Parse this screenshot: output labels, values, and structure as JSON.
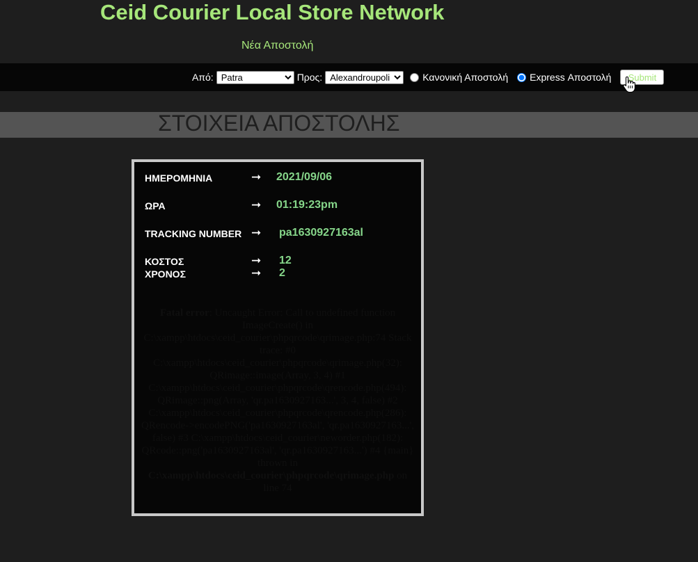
{
  "header": {
    "site_title": "Ceid Courier Local Store Network",
    "nav_link": "Νέα Αποστολή"
  },
  "form": {
    "from_label": "Από:",
    "from_value": "Patra",
    "to_label": "Προς:",
    "to_value": "Alexandroupoli",
    "radio_normal": {
      "label": "Κανονική Αποστολή",
      "checked": false
    },
    "radio_express": {
      "label": "Express Αποστολή",
      "checked": true
    },
    "submit_label": "Submit"
  },
  "section": {
    "title": "ΣΤΟΙΧΕΙΑ ΑΠΟΣΤΟΛΗΣ"
  },
  "details": {
    "date": {
      "label": "ΗΜΕΡΟΜΗΝΙΑ",
      "value": "2021/09/06"
    },
    "time": {
      "label": "ΩΡΑ",
      "value": "01:19:23pm"
    },
    "tracking": {
      "label": "TRACKING NUMBER",
      "value": "pa1630927163al"
    },
    "cost": {
      "label": "ΚΟΣΤΟΣ",
      "value": "12"
    },
    "duration": {
      "label": "ΧΡΟΝΟΣ",
      "value": "2"
    },
    "arrow_icon": "right-arrow-icon"
  },
  "error": {
    "heading": "Fatal error",
    "message": ": Uncaught Error: Call to undefined function ImageCreate() in C:\\xampp\\htdocs\\ceid_courier\\phpqrcode\\qrimage.php:74 Stack trace: #0 C:\\xampp\\htdocs\\ceid_courier\\phpqrcode\\qrimage.php(32): QRimage::image(Array, 3, 4) #1 C:\\xampp\\htdocs\\ceid_courier\\phpqrcode\\qrencode.php(494): QRimage::png(Array, 'qr.pa1630927163...', 3, 4, false) #2 C:\\xampp\\htdocs\\ceid_courier\\phpqrcode\\qrencode.php(286): QRencode->encodePNG('pa1630927163al', 'qr.pa1630927163...', false) #3 C:\\xampp\\htdocs\\ceid_courier\\neworder.php(182): QRcode::png('pa1630927163al', 'qr.pa1630927163...') #4 {main} thrown in ",
    "file": "C:\\xampp\\htdocs\\ceid_courier\\phpqrcode\\qrimage.php",
    "line_text": " on line 74"
  },
  "colors": {
    "background": "#1e1e1e",
    "accent_green": "#a6e67a",
    "value_green": "#86d68a",
    "bar_black": "#060606",
    "band_gray": "#545454"
  }
}
